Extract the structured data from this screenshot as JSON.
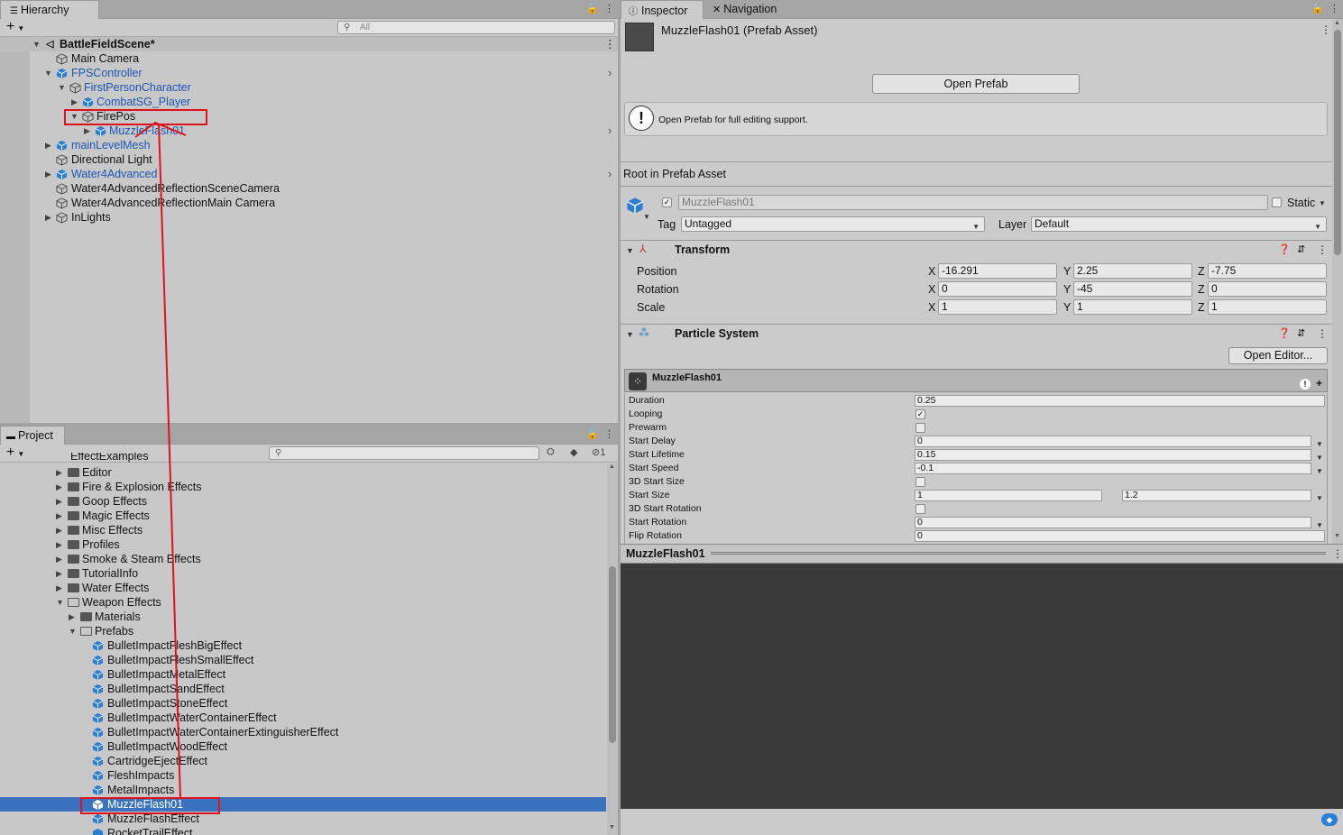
{
  "hierarchy": {
    "tab_label": "Hierarchy",
    "search_placeholder": "All",
    "scene_name": "BattleFieldScene*",
    "items": [
      {
        "label": "Main Camera"
      },
      {
        "label": "FPSController"
      },
      {
        "label": "FirstPersonCharacter"
      },
      {
        "label": "CombatSG_Player"
      },
      {
        "label": "FirePos"
      },
      {
        "label": "MuzzleFlash01"
      },
      {
        "label": "mainLevelMesh"
      },
      {
        "label": "Directional Light"
      },
      {
        "label": "Water4Advanced"
      },
      {
        "label": "Water4AdvancedReflectionSceneCamera"
      },
      {
        "label": "Water4AdvancedReflectionMain Camera"
      },
      {
        "label": "InLights"
      }
    ]
  },
  "project": {
    "tab_label": "Project",
    "hidden_count": "1",
    "partial_top": "EffectExamples",
    "folders": [
      {
        "label": "Editor"
      },
      {
        "label": "Fire & Explosion Effects"
      },
      {
        "label": "Goop Effects"
      },
      {
        "label": "Magic Effects"
      },
      {
        "label": "Misc Effects"
      },
      {
        "label": "Profiles"
      },
      {
        "label": "Smoke & Steam Effects"
      },
      {
        "label": "TutorialInfo"
      },
      {
        "label": "Water Effects"
      },
      {
        "label": "Weapon Effects"
      },
      {
        "label": "Materials"
      },
      {
        "label": "Prefabs"
      }
    ],
    "prefabs": [
      {
        "label": "BulletImpactFleshBigEffect"
      },
      {
        "label": "BulletImpactFleshSmallEffect"
      },
      {
        "label": "BulletImpactMetalEffect"
      },
      {
        "label": "BulletImpactSandEffect"
      },
      {
        "label": "BulletImpactStoneEffect"
      },
      {
        "label": "BulletImpactWaterContainerEffect"
      },
      {
        "label": "BulletImpactWaterContainerExtinguisherEffect"
      },
      {
        "label": "BulletImpactWoodEffect"
      },
      {
        "label": "CartridgeEjectEffect"
      },
      {
        "label": "FleshImpacts"
      },
      {
        "label": "MetalImpacts"
      },
      {
        "label": "MuzzleFlash01"
      },
      {
        "label": "MuzzleFlashEffect"
      },
      {
        "label": "RocketTrailEffect"
      }
    ]
  },
  "inspector": {
    "tab_label": "Inspector",
    "nav_tab_label": "Navigation",
    "asset_title": "MuzzleFlash01 (Prefab Asset)",
    "open_prefab": "Open Prefab",
    "info_text": "Open Prefab for full editing support.",
    "root_label": "Root in Prefab Asset",
    "object_name": "MuzzleFlash01",
    "static_label": "Static",
    "tag_label": "Tag",
    "tag_value": "Untagged",
    "layer_label": "Layer",
    "layer_value": "Default",
    "transform": {
      "title": "Transform",
      "position_label": "Position",
      "rotation_label": "Rotation",
      "scale_label": "Scale",
      "x": "X",
      "y": "Y",
      "z": "Z",
      "position": [
        "-16.291",
        "2.25",
        "-7.75"
      ],
      "rotation": [
        "0",
        "-45",
        "0"
      ],
      "scale": [
        "1",
        "1",
        "1"
      ]
    },
    "particle": {
      "title": "Particle System",
      "open_editor": "Open Editor...",
      "system_name": "MuzzleFlash01",
      "rows": [
        {
          "name": "Duration",
          "value": "0.25"
        },
        {
          "name": "Looping",
          "value": ""
        },
        {
          "name": "Prewarm",
          "value": ""
        },
        {
          "name": "Start Delay",
          "value": "0"
        },
        {
          "name": "Start Lifetime",
          "value": "0.15"
        },
        {
          "name": "Start Speed",
          "value": "-0.1"
        },
        {
          "name": "3D Start Size",
          "value": ""
        },
        {
          "name": "Start Size",
          "value": "1",
          "value2": "1.2"
        },
        {
          "name": "3D Start Rotation",
          "value": ""
        },
        {
          "name": "Start Rotation",
          "value": "0"
        },
        {
          "name": "Flip Rotation",
          "value": "0"
        }
      ]
    },
    "preview_title": "MuzzleFlash01"
  }
}
